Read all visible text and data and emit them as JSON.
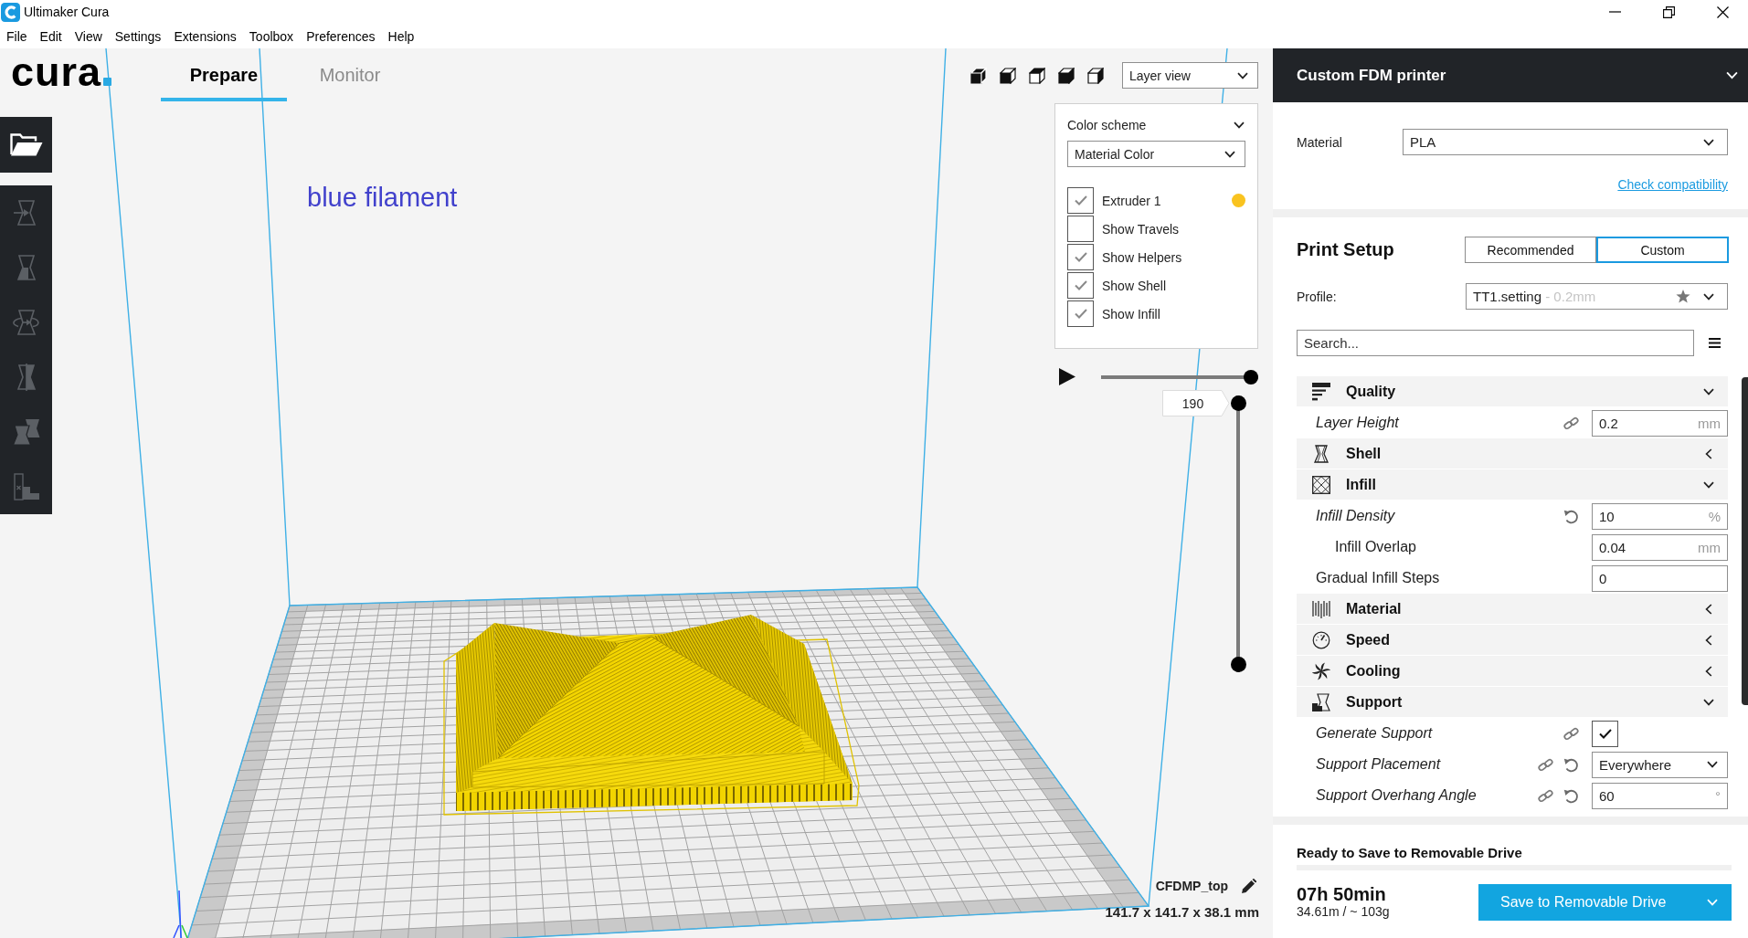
{
  "window": {
    "title": "Ultimaker Cura"
  },
  "menu": [
    "File",
    "Edit",
    "View",
    "Settings",
    "Extensions",
    "Toolbox",
    "Preferences",
    "Help"
  ],
  "header": {
    "logo": "cura",
    "tabs": [
      {
        "label": "Prepare",
        "selected": true
      },
      {
        "label": "Monitor",
        "selected": false
      }
    ]
  },
  "toolbar": {
    "groups": [
      {
        "tools": [
          {
            "kind": "open",
            "disabled": false
          }
        ]
      },
      {
        "tools": [
          {
            "kind": "move",
            "disabled": true
          },
          {
            "kind": "scale",
            "disabled": true
          },
          {
            "kind": "rotate",
            "disabled": true
          },
          {
            "kind": "mirror",
            "disabled": true
          },
          {
            "kind": "per_model",
            "disabled": true
          },
          {
            "kind": "support_blocker",
            "disabled": true
          }
        ]
      }
    ]
  },
  "view": {
    "mode": "Layer view"
  },
  "annotation": "blue filament",
  "layer_panel": {
    "title": "Color scheme",
    "scheme": "Material Color",
    "options": [
      {
        "label": "Extruder 1",
        "checked": true,
        "color": "#f9c31f"
      },
      {
        "label": "Show Travels",
        "checked": false
      },
      {
        "label": "Show Helpers",
        "checked": true
      },
      {
        "label": "Show Shell",
        "checked": true
      },
      {
        "label": "Show Infill",
        "checked": true
      }
    ]
  },
  "path_slider": {
    "level": 1
  },
  "layer_slider": {
    "value": "190",
    "handles": [
      {
        "level": 1
      },
      {
        "level": 0
      }
    ]
  },
  "object_info": {
    "name": "CFDMP_top",
    "dimensions": "141.7 x 141.7 x 38.1 mm"
  },
  "printer": {
    "name": "Custom FDM printer"
  },
  "material": {
    "label": "Material",
    "value": "PLA",
    "link": "Check compatibility"
  },
  "print_setup": {
    "title": "Print Setup",
    "modes": [
      {
        "label": "Recommended",
        "selected": false
      },
      {
        "label": "Custom",
        "selected": true
      }
    ],
    "profile_label": "Profile:",
    "profile": {
      "name": "TT1.setting",
      "detail": "- 0.2mm"
    },
    "search_placeholder": "Search...",
    "categories": [
      {
        "kind": "quality",
        "label": "Quality",
        "expanded": true,
        "settings": [
          {
            "kind": "number",
            "label": "Layer Height",
            "overridden": true,
            "linked": true,
            "resettable": false,
            "value": "0.2",
            "unit": "mm"
          }
        ]
      },
      {
        "kind": "shell",
        "label": "Shell",
        "expanded": false
      },
      {
        "kind": "infill",
        "label": "Infill",
        "expanded": true,
        "settings": [
          {
            "kind": "number",
            "label": "Infill Density",
            "overridden": true,
            "linked": false,
            "resettable": true,
            "value": "10",
            "unit": "%",
            "children": [
              {
                "kind": "number",
                "label": "Infill Overlap",
                "overridden": false,
                "linked": false,
                "resettable": false,
                "value": "0.04",
                "unit": "mm"
              }
            ]
          },
          {
            "kind": "number",
            "label": "Gradual Infill Steps",
            "overridden": false,
            "linked": false,
            "resettable": false,
            "value": "0"
          }
        ]
      },
      {
        "kind": "material",
        "label": "Material",
        "expanded": false
      },
      {
        "kind": "speed",
        "label": "Speed",
        "expanded": false
      },
      {
        "kind": "cooling",
        "label": "Cooling",
        "expanded": false
      },
      {
        "kind": "support",
        "label": "Support",
        "expanded": true,
        "settings": [
          {
            "kind": "checkbox",
            "label": "Generate Support",
            "overridden": true,
            "linked": true,
            "resettable": false,
            "checked": true
          },
          {
            "kind": "select",
            "label": "Support Placement",
            "overridden": true,
            "linked": true,
            "resettable": true,
            "value": "Everywhere"
          },
          {
            "kind": "number",
            "label": "Support Overhang Angle",
            "overridden": true,
            "linked": true,
            "resettable": true,
            "value": "60",
            "unit": "°"
          }
        ]
      }
    ]
  },
  "job": {
    "status": "Ready to Save to Removable Drive",
    "time": "07h 50min",
    "usage": "34.61m / ~ 103g",
    "action": "Save to Removable Drive"
  }
}
